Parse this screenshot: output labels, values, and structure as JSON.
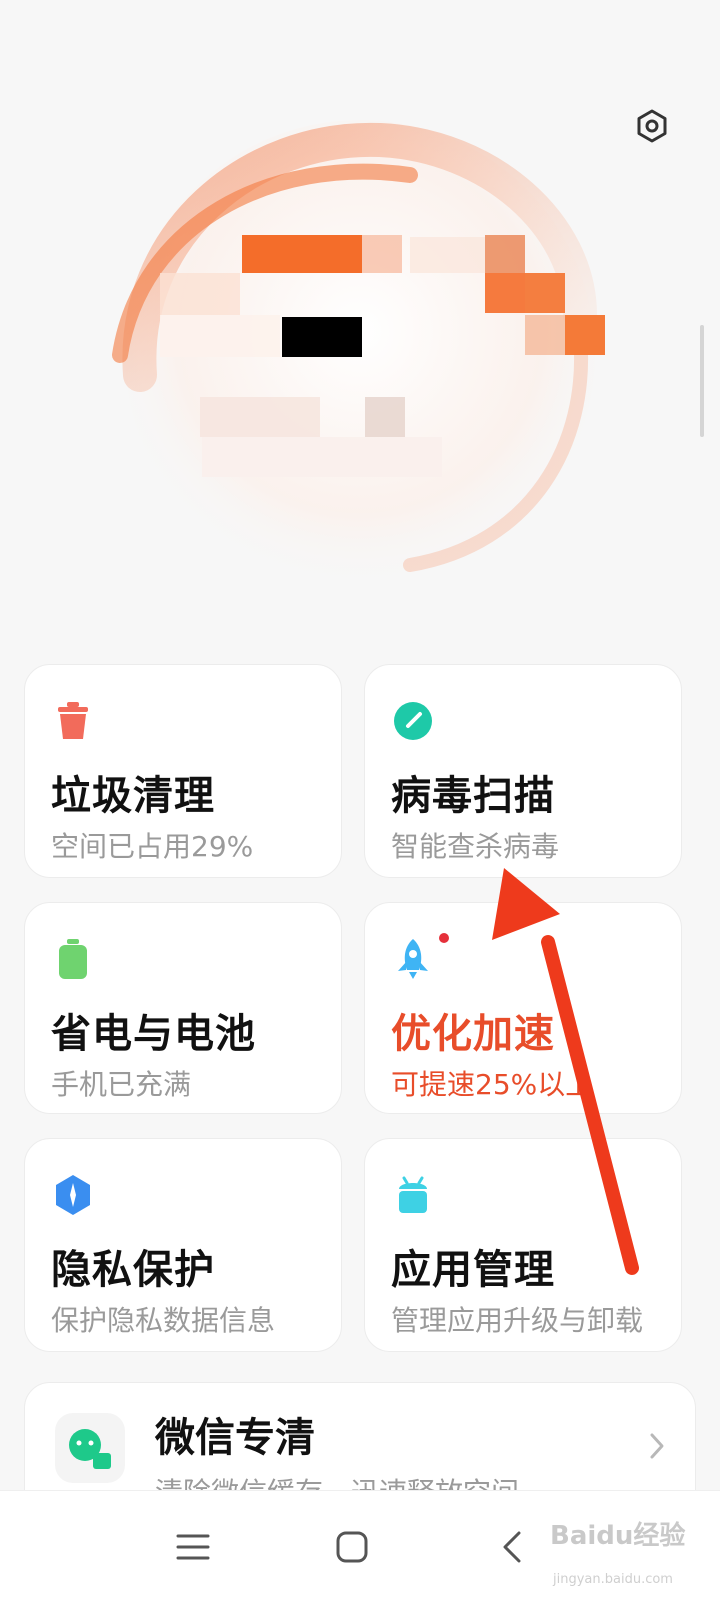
{
  "cards": [
    {
      "title": "垃圾清理",
      "subtitle": "空间已占用29%",
      "icon": "trash-icon",
      "color": "#f26b5b"
    },
    {
      "title": "病毒扫描",
      "subtitle": "智能查杀病毒",
      "icon": "virus-scan-icon",
      "color": "#1ec9a8"
    },
    {
      "title": "省电与电池",
      "subtitle": "手机已充满",
      "icon": "battery-icon",
      "color": "#6fd36f"
    },
    {
      "title": "优化加速",
      "subtitle": "可提速25%以上",
      "icon": "rocket-icon",
      "color": "#3fb4f4",
      "highlight": true
    },
    {
      "title": "隐私保护",
      "subtitle": "保护隐私数据信息",
      "icon": "privacy-shield-icon",
      "color": "#3a8ef0"
    },
    {
      "title": "应用管理",
      "subtitle": "管理应用升级与卸载",
      "icon": "android-icon",
      "color": "#3ed1e4"
    }
  ],
  "wechat": {
    "title": "微信专清",
    "subtitle": "清除微信缓存，迅速释放空间",
    "icon": "wechat-icon"
  },
  "watermark": {
    "text": "Baidu经验",
    "sub": "jingyan.baidu.com"
  },
  "colors": {
    "accent": "#e84d2a",
    "arrow": "#ee3a1c"
  }
}
